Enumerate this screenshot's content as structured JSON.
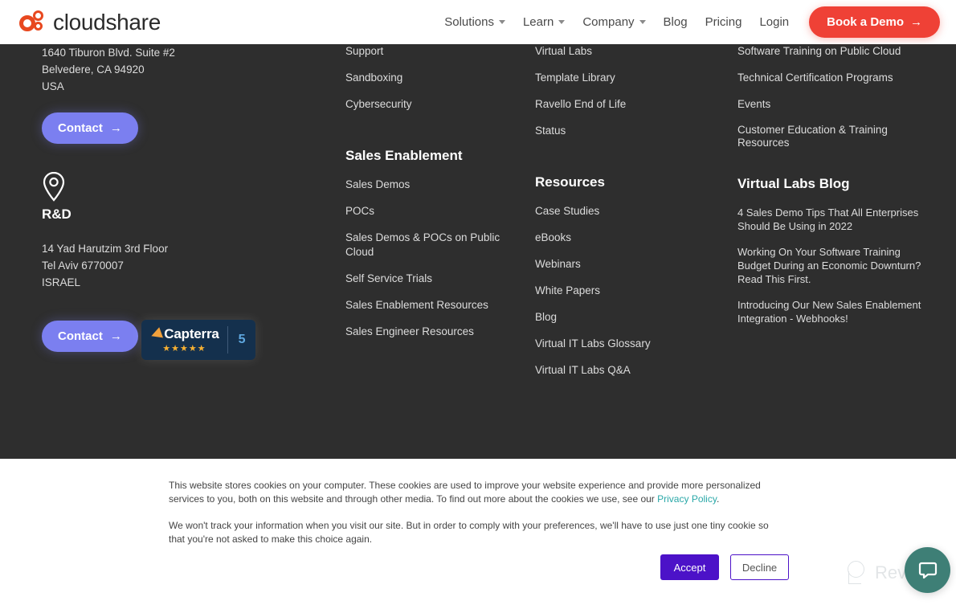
{
  "header": {
    "brand": "cloudshare",
    "logo_icon": "cloudshare-circles-logo",
    "nav": [
      {
        "label": "Solutions",
        "has_caret": true
      },
      {
        "label": "Learn",
        "has_caret": true
      },
      {
        "label": "Company",
        "has_caret": true
      },
      {
        "label": "Blog",
        "has_caret": false
      },
      {
        "label": "Pricing",
        "has_caret": false
      },
      {
        "label": "Login",
        "has_caret": false
      }
    ],
    "cta": {
      "label": "Book a Demo",
      "arrow": "→",
      "color": "#ef4136"
    }
  },
  "footer": {
    "background": "#2e2e2e",
    "hq": {
      "address": [
        "1640 Tiburon Blvd. Suite #2",
        "Belvedere, CA 94920",
        "USA"
      ],
      "contact_label": "Contact",
      "contact_arrow": "→",
      "contact_color": "#7b7ff0"
    },
    "rnd": {
      "pin_icon": "location-pin-icon",
      "title": "R&D",
      "address": [
        "14 Yad Harutzim 3rd Floor",
        "Tel Aviv 6770007",
        "ISRAEL"
      ],
      "contact_label": "Contact",
      "contact_arrow": "→"
    },
    "capterra": {
      "name": "Capterra",
      "stars": "★★★★★",
      "score": "5"
    },
    "column2": {
      "links": [
        "Support",
        "Sandboxing",
        "Cybersecurity"
      ],
      "heading": "Sales Enablement",
      "section_links": [
        "Sales Demos",
        "POCs",
        "Sales Demos & POCs on Public Cloud",
        "Self Service Trials",
        "Sales Enablement Resources",
        "Sales Engineer Resources"
      ]
    },
    "column3": {
      "links": [
        "Virtual Labs",
        "Template Library",
        "Ravello End of Life",
        "Status"
      ],
      "heading": "Resources",
      "section_links": [
        "Case Studies",
        "eBooks",
        "Webinars",
        "White Papers",
        "Blog",
        "Virtual IT Labs Glossary",
        "Virtual IT Labs Q&A"
      ]
    },
    "column4": {
      "links": [
        "Software Training on Public Cloud",
        "Technical Certification Programs",
        "Events",
        "Customer Education & Training Resources"
      ],
      "heading": "Virtual Labs Blog",
      "posts": [
        "4 Sales Demo Tips That All Enterprises Should Be Using in 2022",
        "Working On Your Software Training Budget During an Economic Downturn? Read This First.",
        "Introducing Our New Sales Enablement Integration - Webhooks!"
      ]
    }
  },
  "cookie_banner": {
    "paragraph1_before_link": "This website stores cookies on your computer. These cookies are used to improve your website experience and provide more personalized services to you, both on this website and through other media. To find out more about the cookies we use, see our ",
    "link_label": "Privacy Policy",
    "paragraph1_after_link": ".",
    "paragraph2": "We won't track your information when you visit our site. But in order to comply with your preferences, we'll have to use just one tiny cookie so that you're not asked to make this choice again.",
    "accept_label": "Accept",
    "decline_label": "Decline",
    "accept_color": "#4c12c8",
    "link_color": "#2aa8a8"
  },
  "watermark": {
    "label": "Revain",
    "icon": "revain-logo-icon"
  },
  "chat_widget": {
    "icon": "chat-bubble-icon",
    "color": "#3e7f76"
  }
}
